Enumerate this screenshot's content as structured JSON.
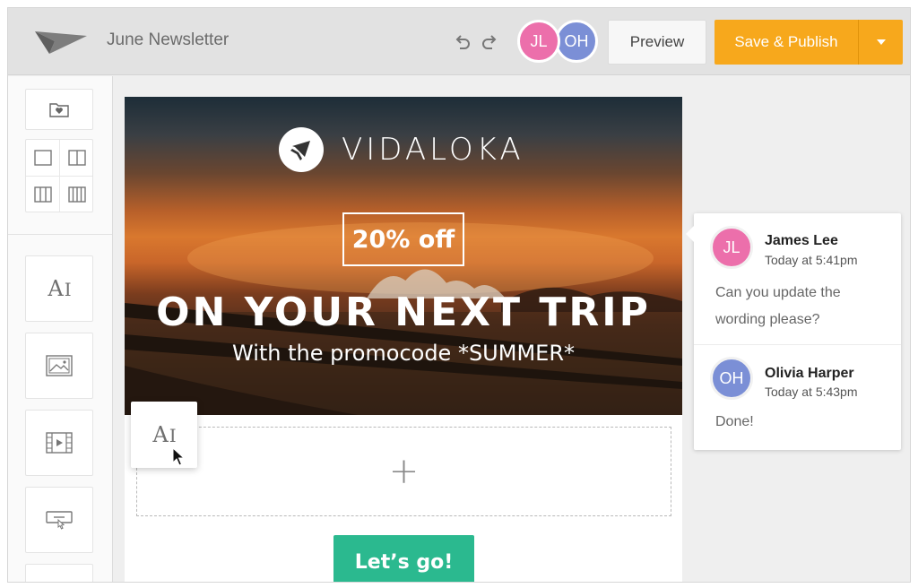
{
  "header": {
    "title": "June Newsletter",
    "collaborators": [
      "JL",
      "OH"
    ],
    "preview_label": "Preview",
    "publish_label": "Save & Publish"
  },
  "sidebar": {
    "tools": [
      "saved-blocks",
      "layout-1col",
      "layout-2col",
      "layout-3col",
      "layout-4col",
      "text",
      "image",
      "video",
      "button"
    ],
    "text_tool_glyph": "A",
    "text_tool_glyph_small": "I"
  },
  "email": {
    "brand": "VIDALOKA",
    "promo": "20% off",
    "headline": "ON YOUR NEXT TRIP",
    "subheadline": "With the promocode *SUMMER*",
    "drop_zone_symbol": "+",
    "cta_label": "Let’s go!"
  },
  "drag_block": {
    "glyph": "A",
    "glyph_small": "I"
  },
  "comments": [
    {
      "initials": "JL",
      "author": "James Lee",
      "time": "Today at 5:41pm",
      "text": "Can you update the wording please?"
    },
    {
      "initials": "OH",
      "author": "Olivia Harper",
      "time": "Today at 5:43pm",
      "text": "Done!"
    }
  ],
  "colors": {
    "accent_orange": "#f7a81c",
    "cta_green": "#2bb98f",
    "avatar_pink": "#ec6fab",
    "avatar_blue": "#7b8fd6"
  }
}
